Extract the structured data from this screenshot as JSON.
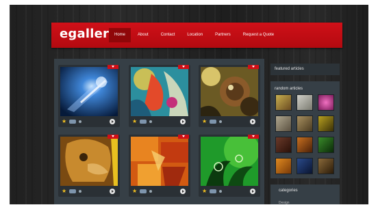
{
  "site": {
    "logo": "egallery",
    "accent": "#c40c13"
  },
  "nav": {
    "items": [
      {
        "label": "Home",
        "active": true
      },
      {
        "label": "About"
      },
      {
        "label": "Contact"
      },
      {
        "label": "Location"
      },
      {
        "label": "Partners"
      },
      {
        "label": "Request a Quote"
      }
    ]
  },
  "gallery": {
    "tiles": [
      {
        "art": "blue-light"
      },
      {
        "art": "colorful-abstract"
      },
      {
        "art": "steampunk-face"
      },
      {
        "art": "golden-mask"
      },
      {
        "art": "orange-abstract"
      },
      {
        "art": "green-floral"
      }
    ]
  },
  "sidebar": {
    "featured_title": "featured articles",
    "random_title": "random articles",
    "categories_title": "categories",
    "category_first": "Design"
  }
}
